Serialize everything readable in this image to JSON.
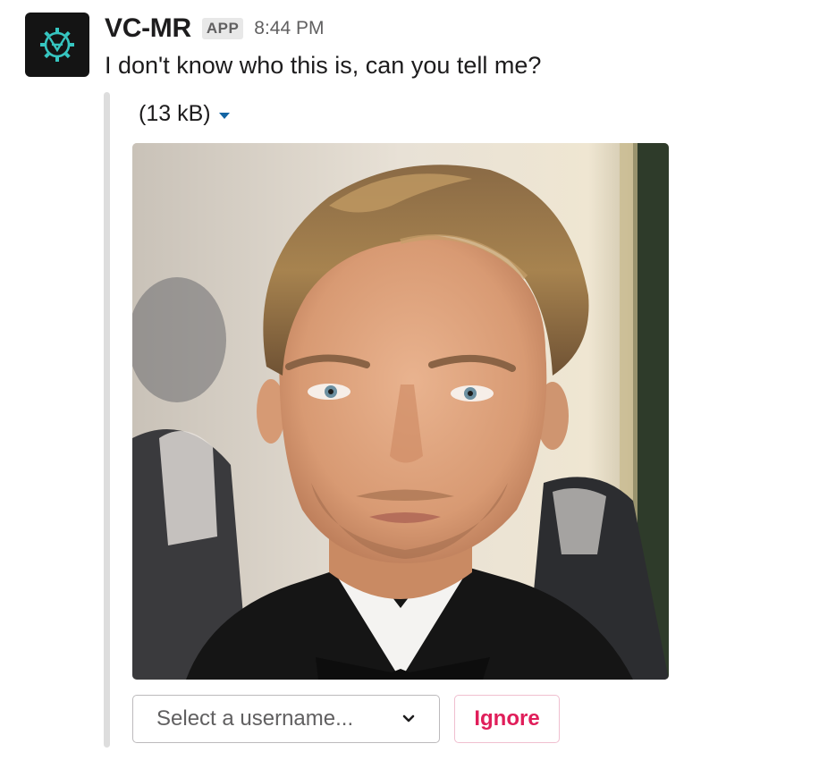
{
  "message": {
    "sender": "VC-MR",
    "badge": "APP",
    "timestamp": "8:44 PM",
    "text": "I don't know who this is, can you tell me?"
  },
  "attachment": {
    "size": "(13 kB)",
    "caret_icon": "caret-down-icon",
    "image_icon": "portrait-photo"
  },
  "actions": {
    "select_placeholder": "Select a username...",
    "select_icon": "chevron-down-icon",
    "ignore_label": "Ignore"
  },
  "colors": {
    "ignore": "#e01e5a",
    "link": "#1264a3",
    "logo": "#36c5c0"
  }
}
